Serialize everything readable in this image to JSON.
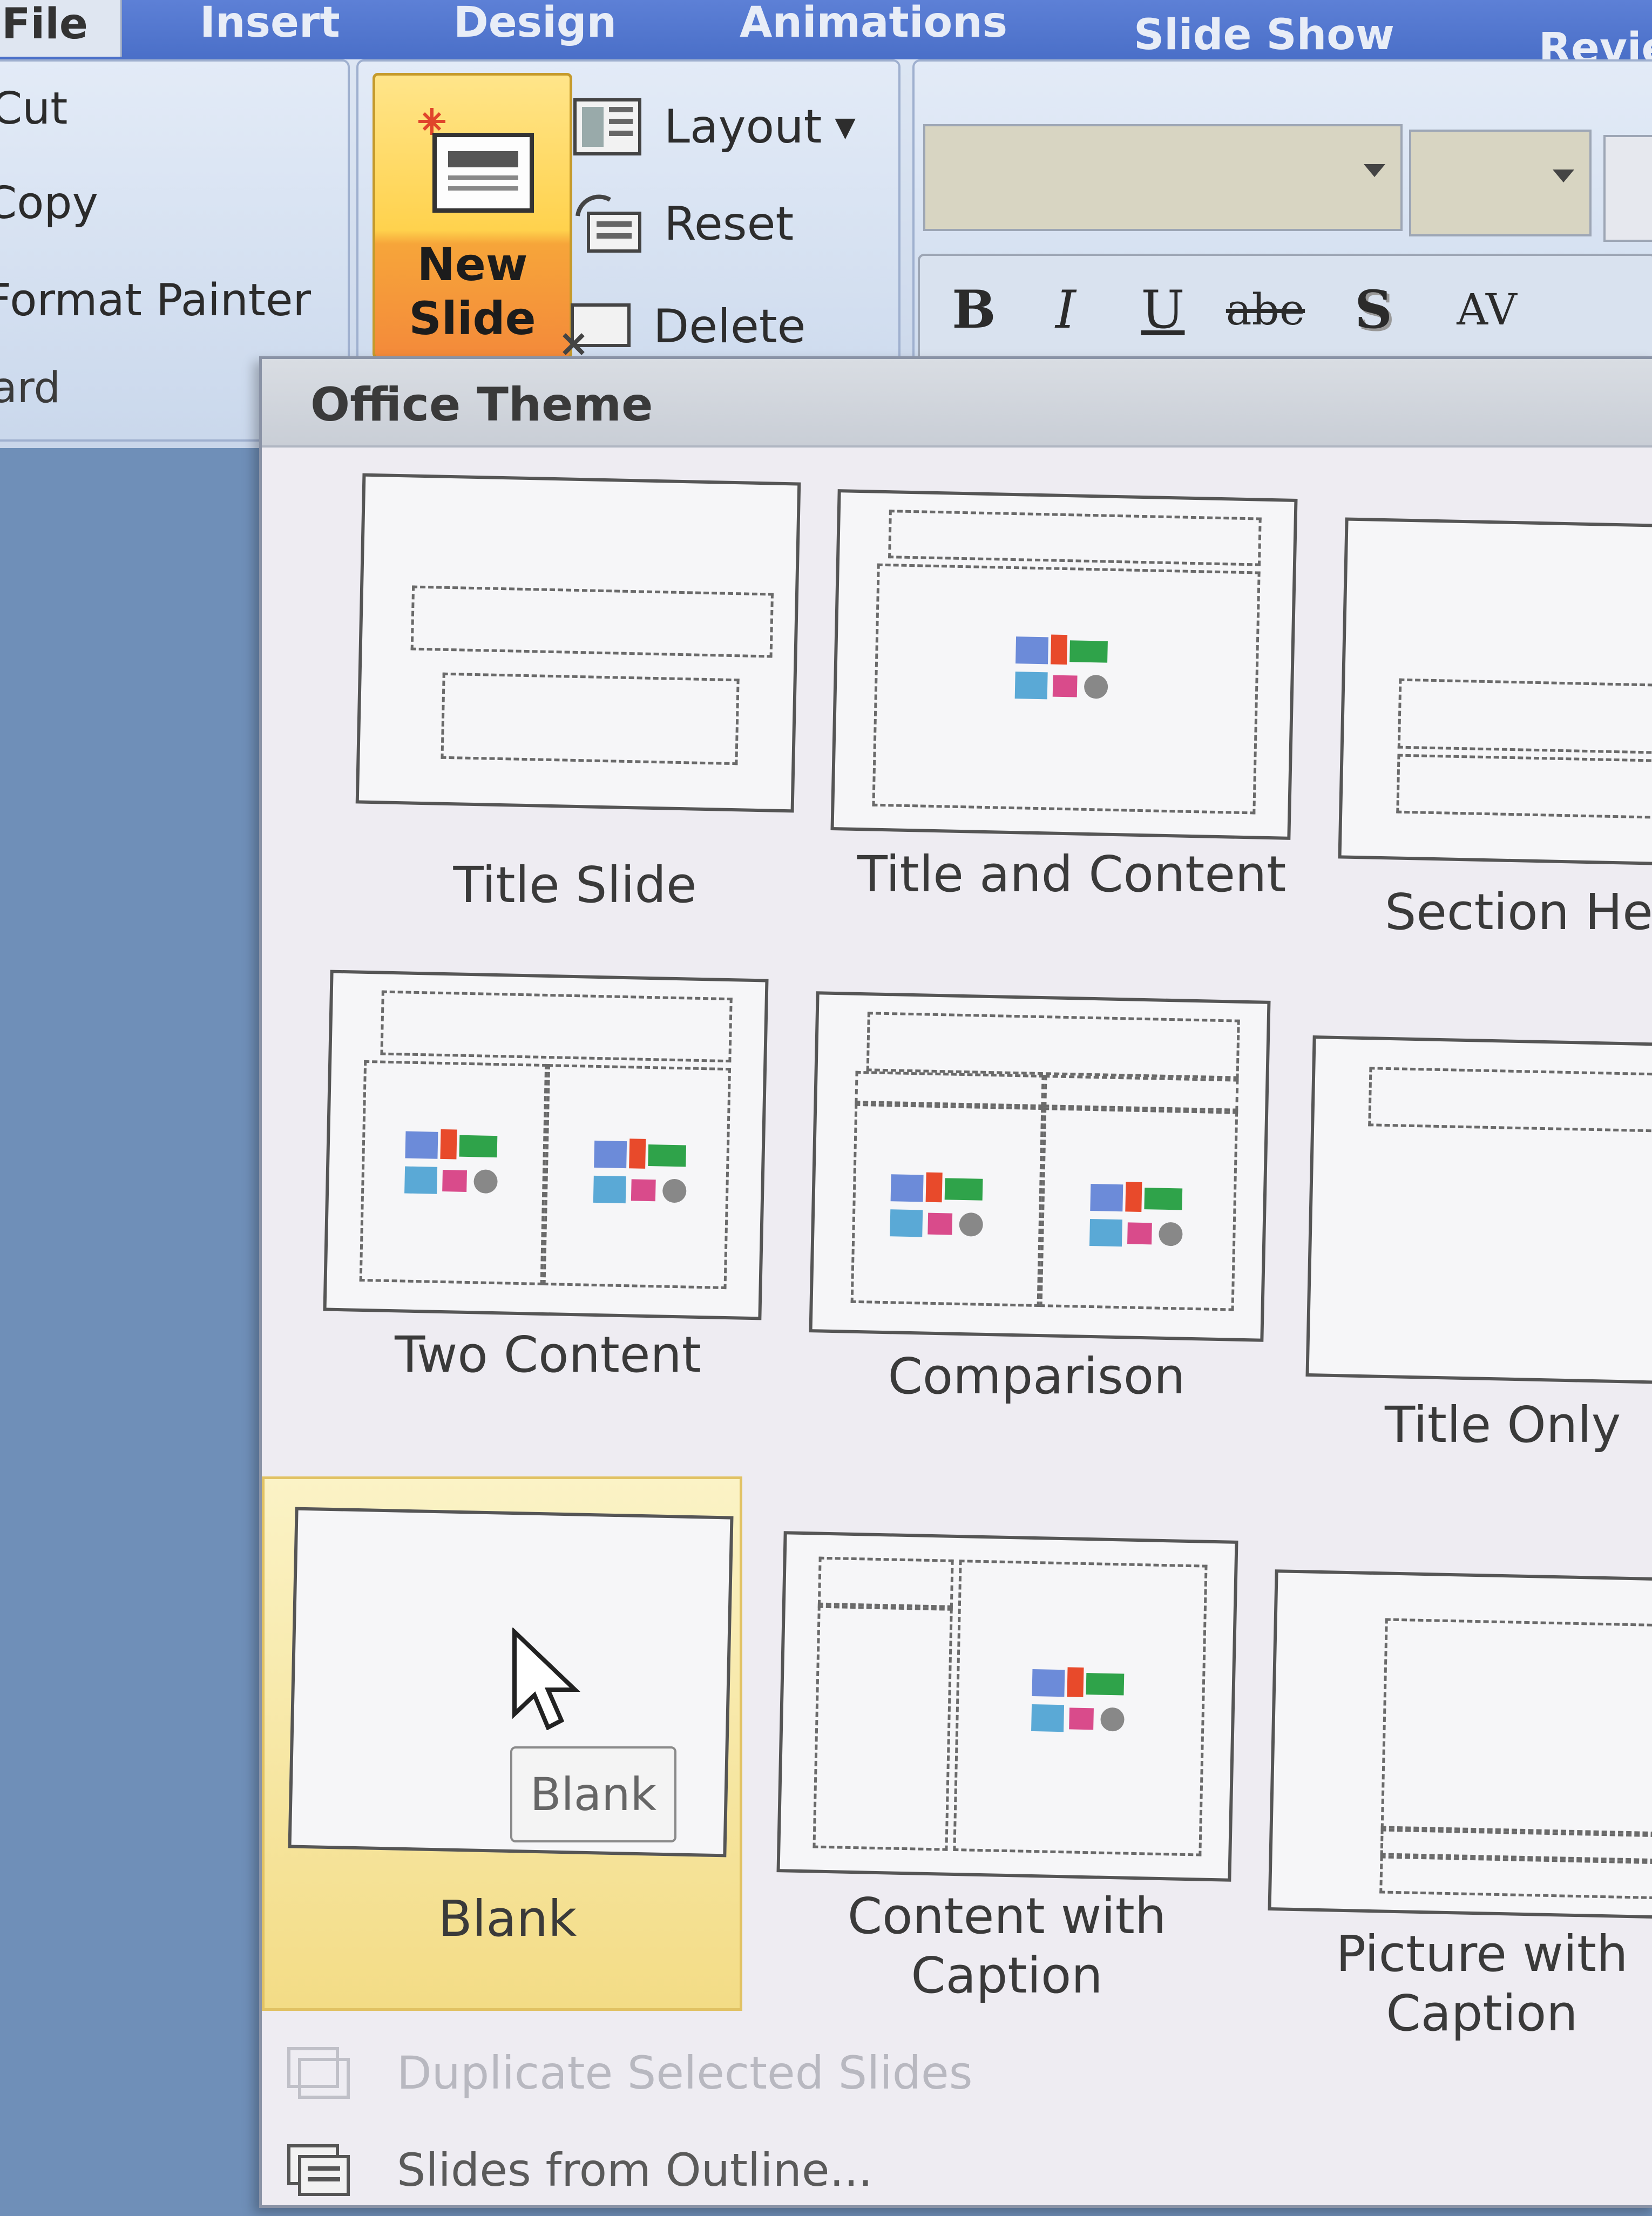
{
  "tabs": [
    "File",
    "Insert",
    "Design",
    "Animations",
    "Slide Show",
    "Revie"
  ],
  "clipboard": {
    "items": [
      "Cut",
      "Copy",
      "Format Painter"
    ],
    "group_label": "ard"
  },
  "slides": {
    "new_slide_label": "New Slide",
    "commands": [
      "Layout",
      "Reset",
      "Delete"
    ]
  },
  "font": {
    "format_buttons": [
      "B",
      "I",
      "U",
      "abe",
      "S",
      "AV"
    ]
  },
  "gallery": {
    "header": "Office Theme",
    "layouts": [
      "Title Slide",
      "Title and Content",
      "Section He",
      "Two Content",
      "Comparison",
      "Title Only",
      "Blank",
      "Content with Caption",
      "Picture with Caption"
    ],
    "hovered_layout": "Blank",
    "tooltip": "Blank",
    "commands": [
      {
        "label": "Duplicate Selected Slides",
        "disabled": true
      },
      {
        "label": "Slides from Outline...",
        "disabled": false
      }
    ]
  },
  "colors": {
    "tab_bar": "#4a6fc8",
    "hover": "#f3dc86",
    "new_slide_top": "#ffd24d",
    "new_slide_bottom": "#f48a3a"
  }
}
